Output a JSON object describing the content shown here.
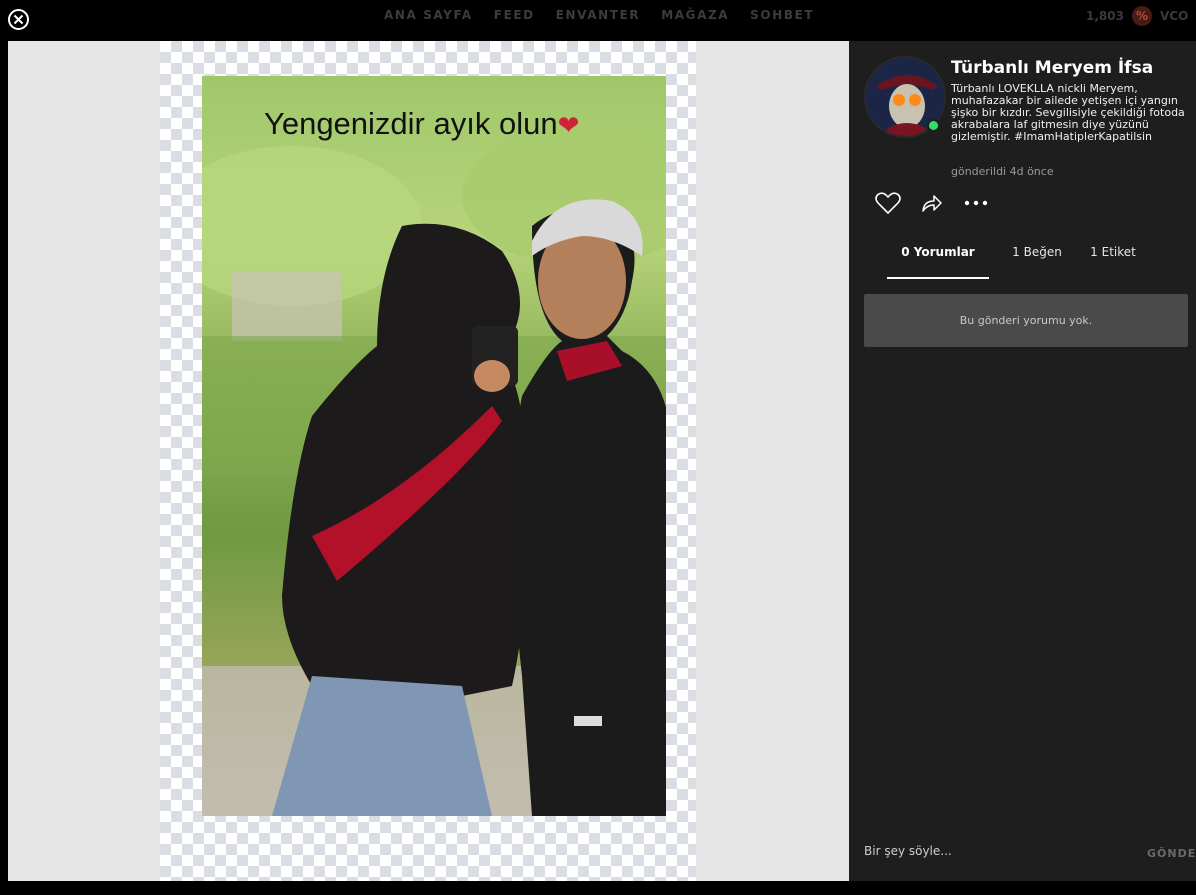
{
  "nav": {
    "items": [
      {
        "label": "ANA SAYFA"
      },
      {
        "label": "FEED"
      },
      {
        "label": "ENVANTER"
      },
      {
        "label": "MAĞAZA"
      },
      {
        "label": "SOHBET"
      }
    ],
    "coin_count": "1,803",
    "coin_symbol": "%",
    "currency_label": "VCO"
  },
  "image": {
    "caption": "Yengenizdir  ayık olun",
    "caption_emoji": "❤"
  },
  "post": {
    "title": "Türbanlı Meryem İfsa",
    "description": "Türbanlı LOVEKLLA nickli Meryem, muhafazakar bir ailede yetişen içi yangın şişko bir kızdır. Sevgilisiyle çekildiği fotoda akrabalara laf gitmesin diye yüzünü gizlemiştir. #ImamHatiplerKapatilsin",
    "time": "gönderildi 4d önce"
  },
  "tabs": [
    {
      "label": "0 Yorumlar",
      "active": true
    },
    {
      "label": "1 Beğen",
      "active": false
    },
    {
      "label": "1 Etiket",
      "active": false
    }
  ],
  "comments": {
    "empty_text": "Bu gönderi yorumu yok.",
    "input_placeholder": "Bir şey söyle...",
    "send_label": "GÖNDER"
  },
  "colors": {
    "online": "#2ee06a",
    "sidebar_bg": "#1e1e1e",
    "viewer_bg": "#e6e6e6"
  }
}
